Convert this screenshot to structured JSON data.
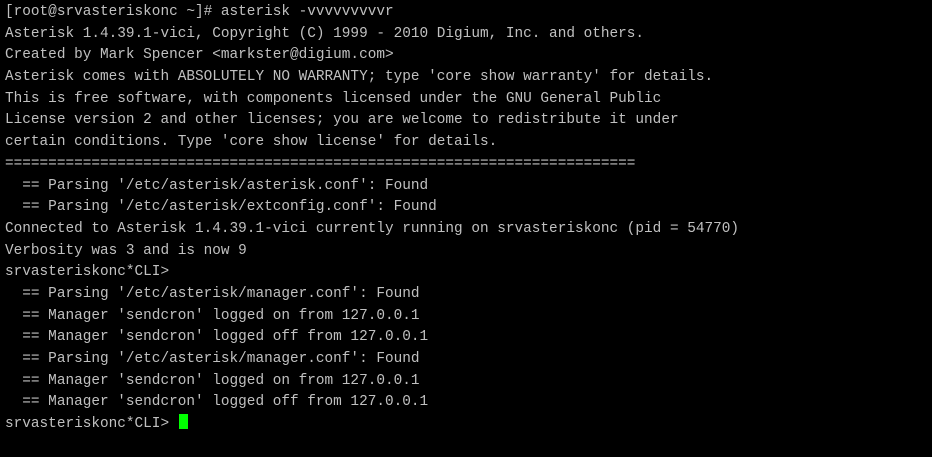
{
  "terminal": {
    "text_color": "#c0c0c0",
    "background_color": "#000000",
    "cursor_color": "#00ff00",
    "lines": [
      "[root@srvasteriskonc ~]# asterisk -vvvvvvvvvr",
      "Asterisk 1.4.39.1-vici, Copyright (C) 1999 - 2010 Digium, Inc. and others.",
      "Created by Mark Spencer <markster@digium.com>",
      "Asterisk comes with ABSOLUTELY NO WARRANTY; type 'core show warranty' for details.",
      "This is free software, with components licensed under the GNU General Public",
      "License version 2 and other licenses; you are welcome to redistribute it under",
      "certain conditions. Type 'core show license' for details.",
      "=========================================================================",
      "  == Parsing '/etc/asterisk/asterisk.conf': Found",
      "  == Parsing '/etc/asterisk/extconfig.conf': Found",
      "Connected to Asterisk 1.4.39.1-vici currently running on srvasteriskonc (pid = 54770)",
      "Verbosity was 3 and is now 9",
      "srvasteriskonc*CLI>",
      "  == Parsing '/etc/asterisk/manager.conf': Found",
      "  == Manager 'sendcron' logged on from 127.0.0.1",
      "  == Manager 'sendcron' logged off from 127.0.0.1",
      "  == Parsing '/etc/asterisk/manager.conf': Found",
      "  == Manager 'sendcron' logged on from 127.0.0.1",
      "  == Manager 'sendcron' logged off from 127.0.0.1"
    ],
    "prompt": "srvasteriskonc*CLI> "
  }
}
